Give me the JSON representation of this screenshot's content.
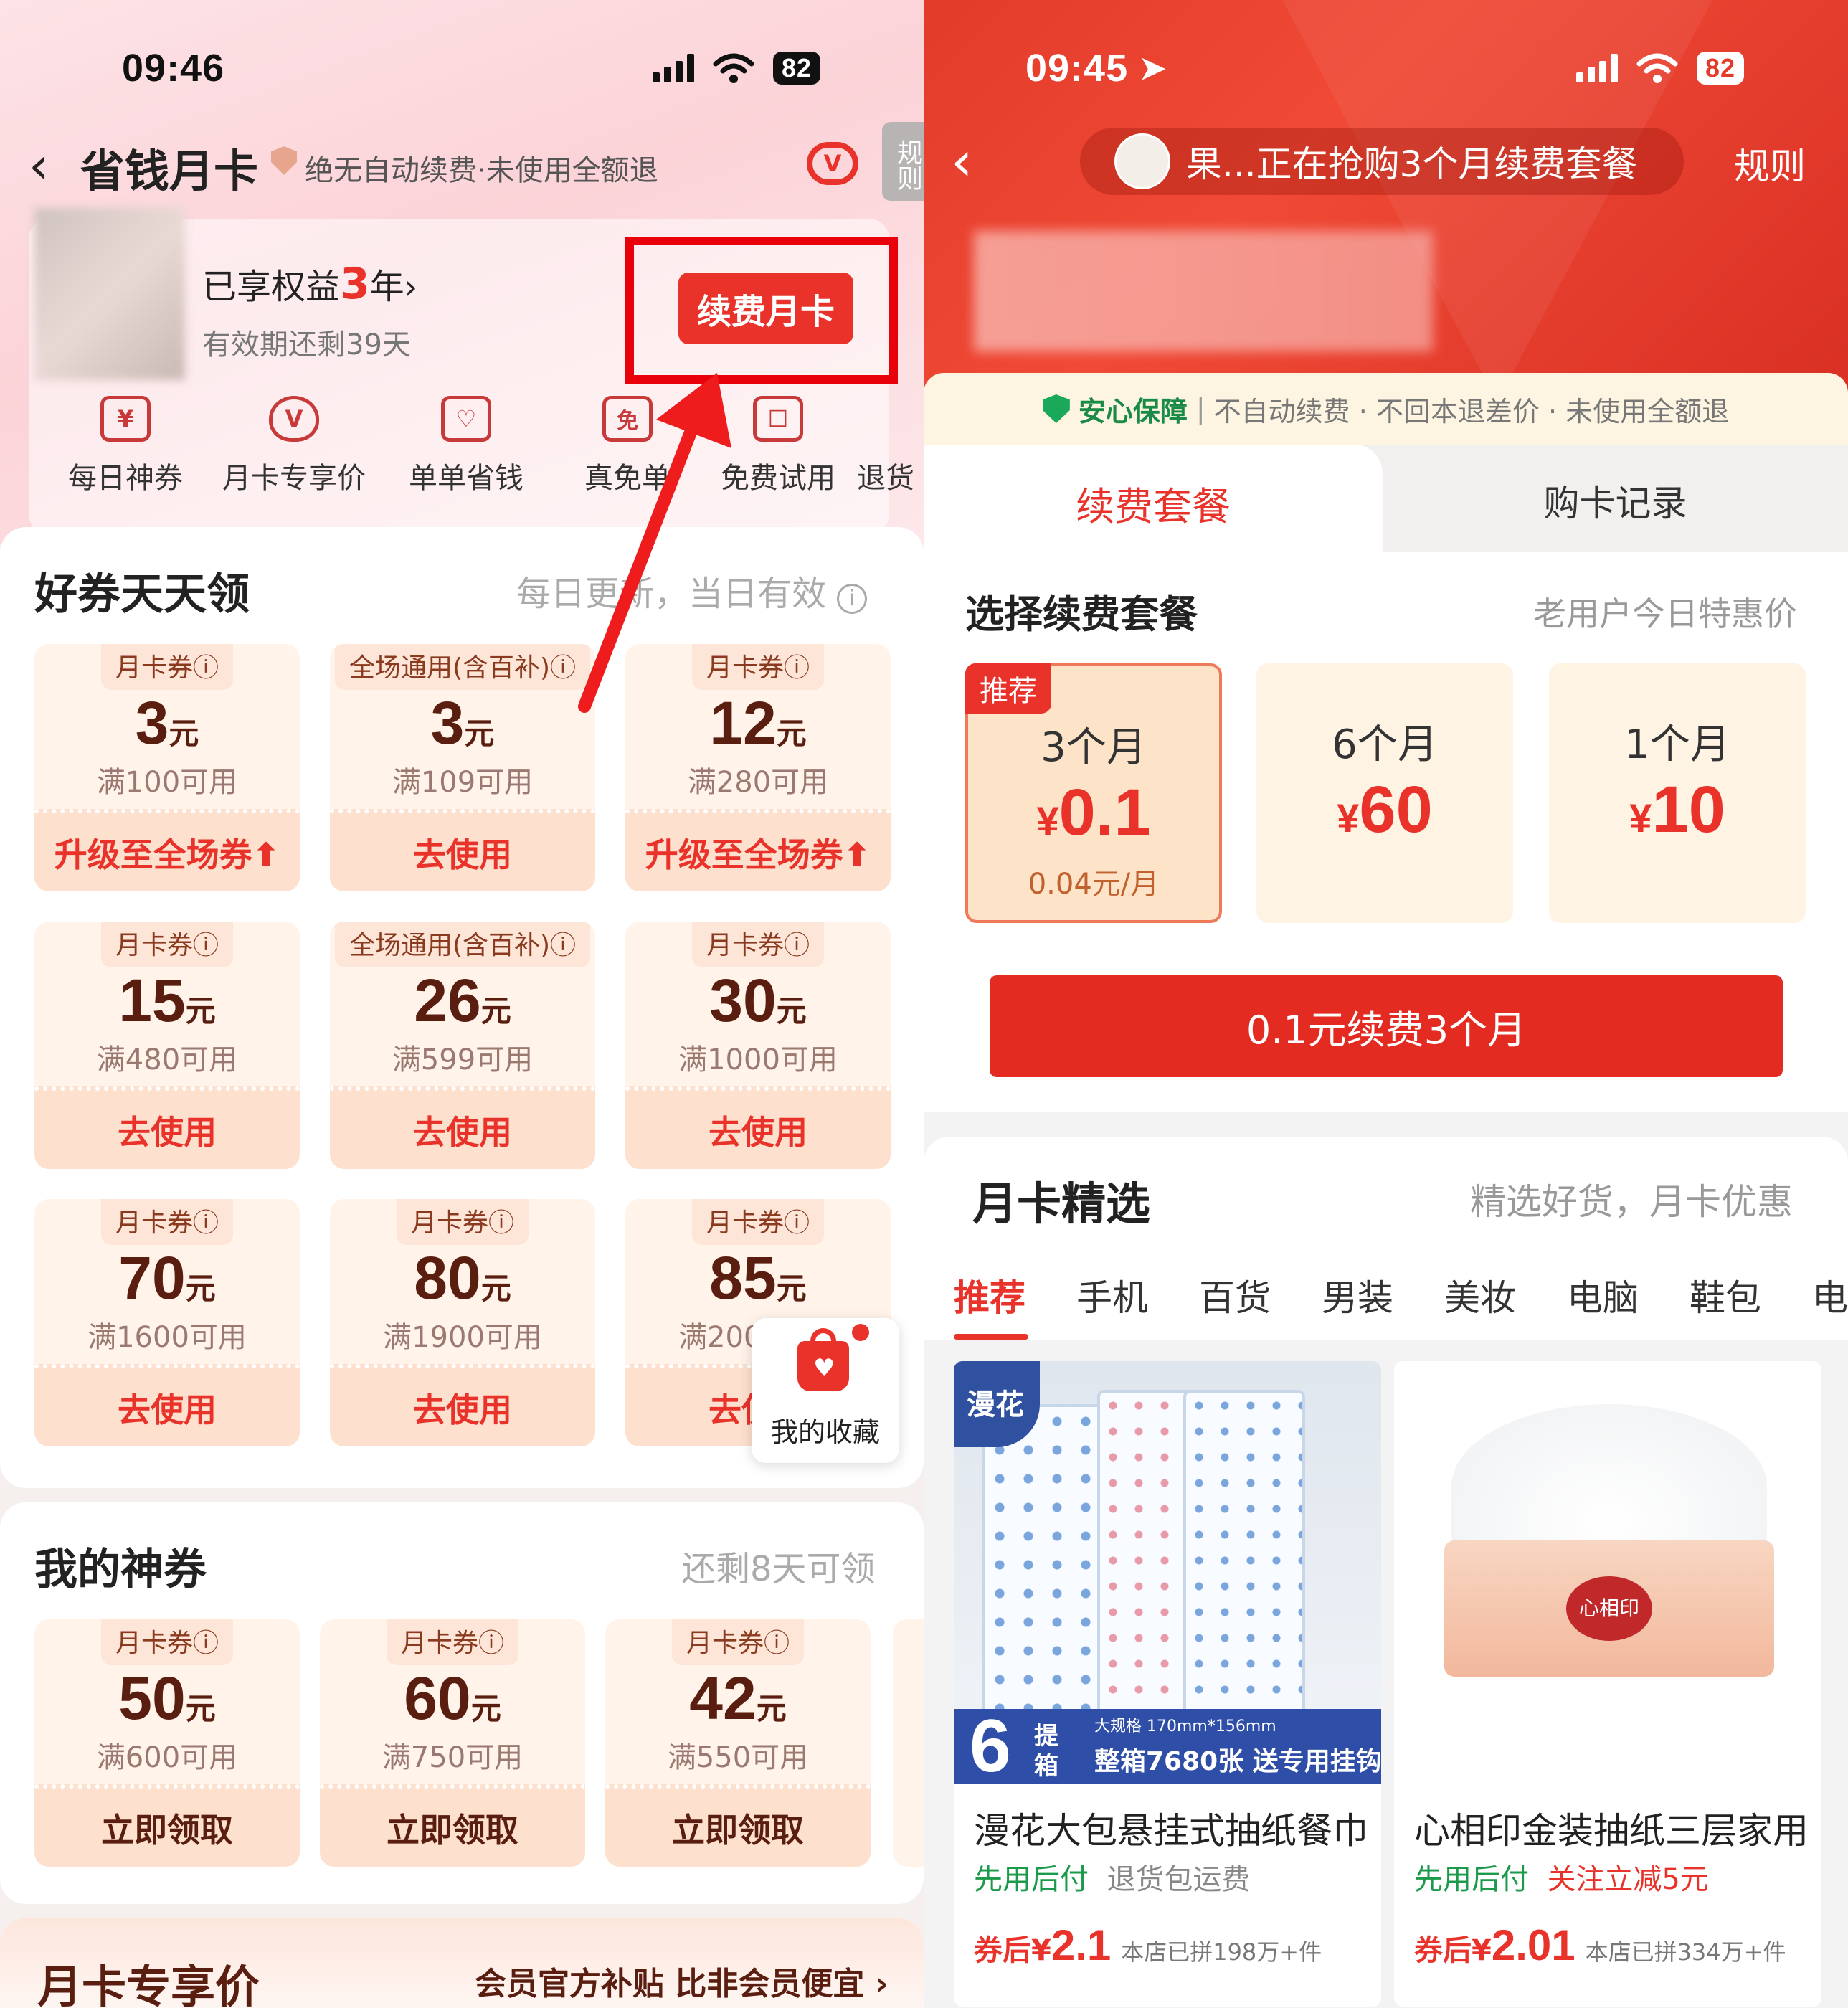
{
  "left": {
    "status": {
      "time": "09:46",
      "battery": "82"
    },
    "header": {
      "title": "省钱月卡",
      "subtitle": "绝无自动续费·未使用全额退",
      "rules": "规则"
    },
    "member": {
      "prefix": "已享权益",
      "years": "3",
      "suffix": "年",
      "expire": "有效期还剩39天",
      "renew_button": "续费月卡"
    },
    "nav": [
      {
        "label": "每日神券",
        "glyph": "¥"
      },
      {
        "label": "月卡专享价",
        "glyph": "V"
      },
      {
        "label": "单单省钱",
        "glyph": "♡"
      },
      {
        "label": "真免单",
        "glyph": "免"
      },
      {
        "label": "免费试用",
        "glyph": "☐"
      },
      {
        "label": "退货",
        "glyph": ""
      }
    ],
    "daily": {
      "title": "好券天天领",
      "note": "每日更新，当日有效",
      "coupons": [
        {
          "tag": "月卡券ⓘ",
          "amount": "3",
          "unit": "元",
          "cond": "满100可用",
          "btn": "升级至全场券⬆"
        },
        {
          "tag": "全场通用(含百补)ⓘ",
          "amount": "3",
          "unit": "元",
          "cond": "满109可用",
          "btn": "去使用"
        },
        {
          "tag": "月卡券ⓘ",
          "amount": "12",
          "unit": "元",
          "cond": "满280可用",
          "btn": "升级至全场券⬆"
        },
        {
          "tag": "月卡券ⓘ",
          "amount": "15",
          "unit": "元",
          "cond": "满480可用",
          "btn": "去使用"
        },
        {
          "tag": "全场通用(含百补)ⓘ",
          "amount": "26",
          "unit": "元",
          "cond": "满599可用",
          "btn": "去使用"
        },
        {
          "tag": "月卡券ⓘ",
          "amount": "30",
          "unit": "元",
          "cond": "满1000可用",
          "btn": "去使用"
        },
        {
          "tag": "月卡券ⓘ",
          "amount": "70",
          "unit": "元",
          "cond": "满1600可用",
          "btn": "去使用"
        },
        {
          "tag": "月卡券ⓘ",
          "amount": "80",
          "unit": "元",
          "cond": "满1900可用",
          "btn": "去使用"
        },
        {
          "tag": "月卡券ⓘ",
          "amount": "85",
          "unit": "元",
          "cond": "满2000可用",
          "btn": "去使用"
        }
      ]
    },
    "favorites": {
      "label": "我的收藏"
    },
    "mine": {
      "title": "我的神券",
      "note": "还剩8天可领",
      "coupons": [
        {
          "tag": "月卡券ⓘ",
          "amount": "50",
          "unit": "元",
          "cond": "满600可用",
          "btn": "立即领取"
        },
        {
          "tag": "月卡券ⓘ",
          "amount": "60",
          "unit": "元",
          "cond": "满750可用",
          "btn": "立即领取"
        },
        {
          "tag": "月卡券ⓘ",
          "amount": "42",
          "unit": "元",
          "cond": "满550可用",
          "btn": "立即领取"
        }
      ]
    },
    "exclusive": {
      "title": "月卡专享价",
      "note": "会员官方补贴 比非会员便宜 ›"
    }
  },
  "right": {
    "status": {
      "time": "09:45",
      "battery": "82"
    },
    "header": {
      "ticker": "果...正在抢购3个月续费套餐",
      "rules": "规则"
    },
    "guarantee": {
      "label": "安心保障",
      "text": "不自动续费 · 不回本退差价 · 未使用全额退"
    },
    "tabs": [
      "续费套餐",
      "购卡记录"
    ],
    "select": {
      "title": "选择续费套餐",
      "note": "老用户今日特惠价",
      "packages": [
        {
          "badge": "推荐",
          "months": "3个月",
          "currency": "¥",
          "price": "0.1",
          "per": "0.04元/月"
        },
        {
          "badge": "",
          "months": "6个月",
          "currency": "¥",
          "price": "60",
          "per": ""
        },
        {
          "badge": "",
          "months": "1个月",
          "currency": "¥",
          "price": "10",
          "per": ""
        }
      ],
      "cta": "0.1元续费3个月"
    },
    "picks": {
      "title": "月卡精选",
      "note": "精选好货，月卡优惠",
      "categories": [
        "推荐",
        "手机",
        "百货",
        "男装",
        "美妆",
        "电脑",
        "鞋包",
        "电"
      ],
      "products": [
        {
          "name": "漫花大包悬挂式抽纸餐巾",
          "pay": "先用后付",
          "extra": "退货包运费",
          "price_prefix": "券后¥",
          "price": "2.1",
          "sold": "本店已拼198万+件",
          "brand": "漫花",
          "promo_num": "6",
          "promo_a": "提",
          "promo_b": "箱",
          "spec": "大规格 170mm*156mm",
          "promo": "整箱7680张 送专用挂钩"
        },
        {
          "name": "心相印金装抽纸三层家用",
          "pay": "先用后付",
          "extra": "关注立减5元",
          "price_prefix": "券后¥",
          "price": "2.01",
          "sold": "本店已拼334万+件",
          "brand": "心相印"
        }
      ]
    }
  }
}
